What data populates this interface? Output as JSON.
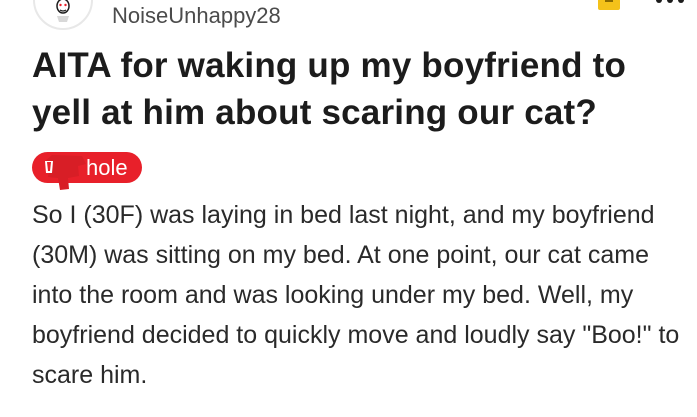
{
  "post": {
    "author": {
      "username": "NoiseUnhappy28",
      "avatar_icon": "snoo-avatar-icon"
    },
    "header_icons": {
      "award": "award-icon",
      "more": "more-options-icon"
    },
    "title": "AITA for waking up my boyfriend to yell at him about scaring our cat?",
    "flair": {
      "label": "hole",
      "emoji_icon": "asshole-flair-emoji-icon",
      "color": "#e8202a"
    },
    "body": "So I (30F) was laying in bed last night, and my boyfriend (30M) was sitting on my bed. At one point, our cat came into the room and was looking under my bed. Well, my boyfriend decided to quickly move and loudly say \"Boo!\" to scare him."
  }
}
